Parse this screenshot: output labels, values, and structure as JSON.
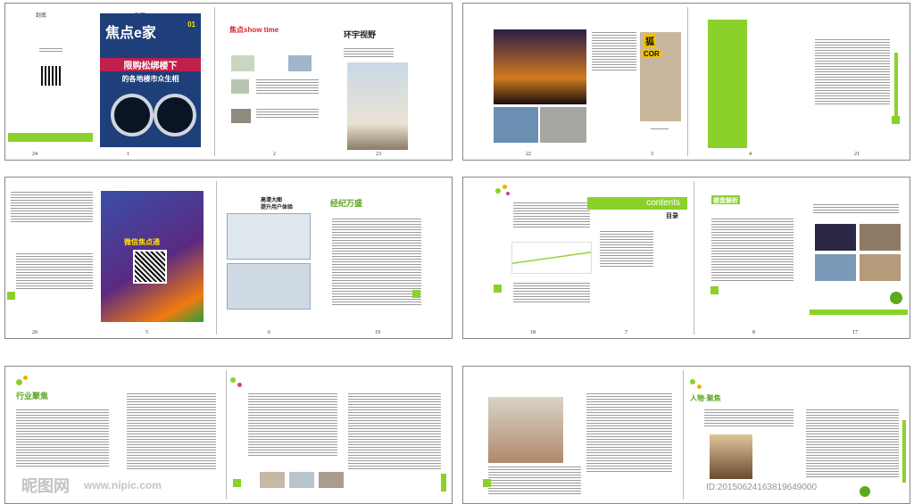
{
  "spreads": [
    {
      "pages": [
        "24",
        "1",
        "2",
        "23"
      ],
      "labels": [
        "封底",
        "封面"
      ]
    },
    {
      "pages": [
        "22",
        "3",
        "4",
        "21"
      ]
    },
    {
      "pages": [
        "20",
        "5",
        "6",
        "19"
      ]
    },
    {
      "pages": [
        "18",
        "7",
        "8",
        "17"
      ]
    }
  ],
  "cover": {
    "title": "焦点e家",
    "issue": "01",
    "banner": "限购松绑楼下",
    "subtitle": "的各地楼市众生相"
  },
  "headings": {
    "show_time": "焦点show time",
    "global_view": "环宇视野",
    "jingji": "经纪万盛",
    "contents": "contents",
    "mulu": "目录",
    "loupan": "楼盘解析",
    "hangye": "行业聚焦",
    "renwu": "人物·聚焦",
    "wechat": "微信焦点通",
    "ganggao": "高清大图",
    "ganggao_sub": "提升用户体验",
    "fox_logo": "狐",
    "cor": "COR"
  },
  "watermark": {
    "logo": "昵图网",
    "url": "www.nipic.com",
    "id": "ID:20150624163819649000"
  },
  "colors": {
    "accent_green": "#8bd12b",
    "cover_blue": "#1f3f7a",
    "promo_purple": "#5a2a82",
    "promo_orange": "#f07a10"
  }
}
